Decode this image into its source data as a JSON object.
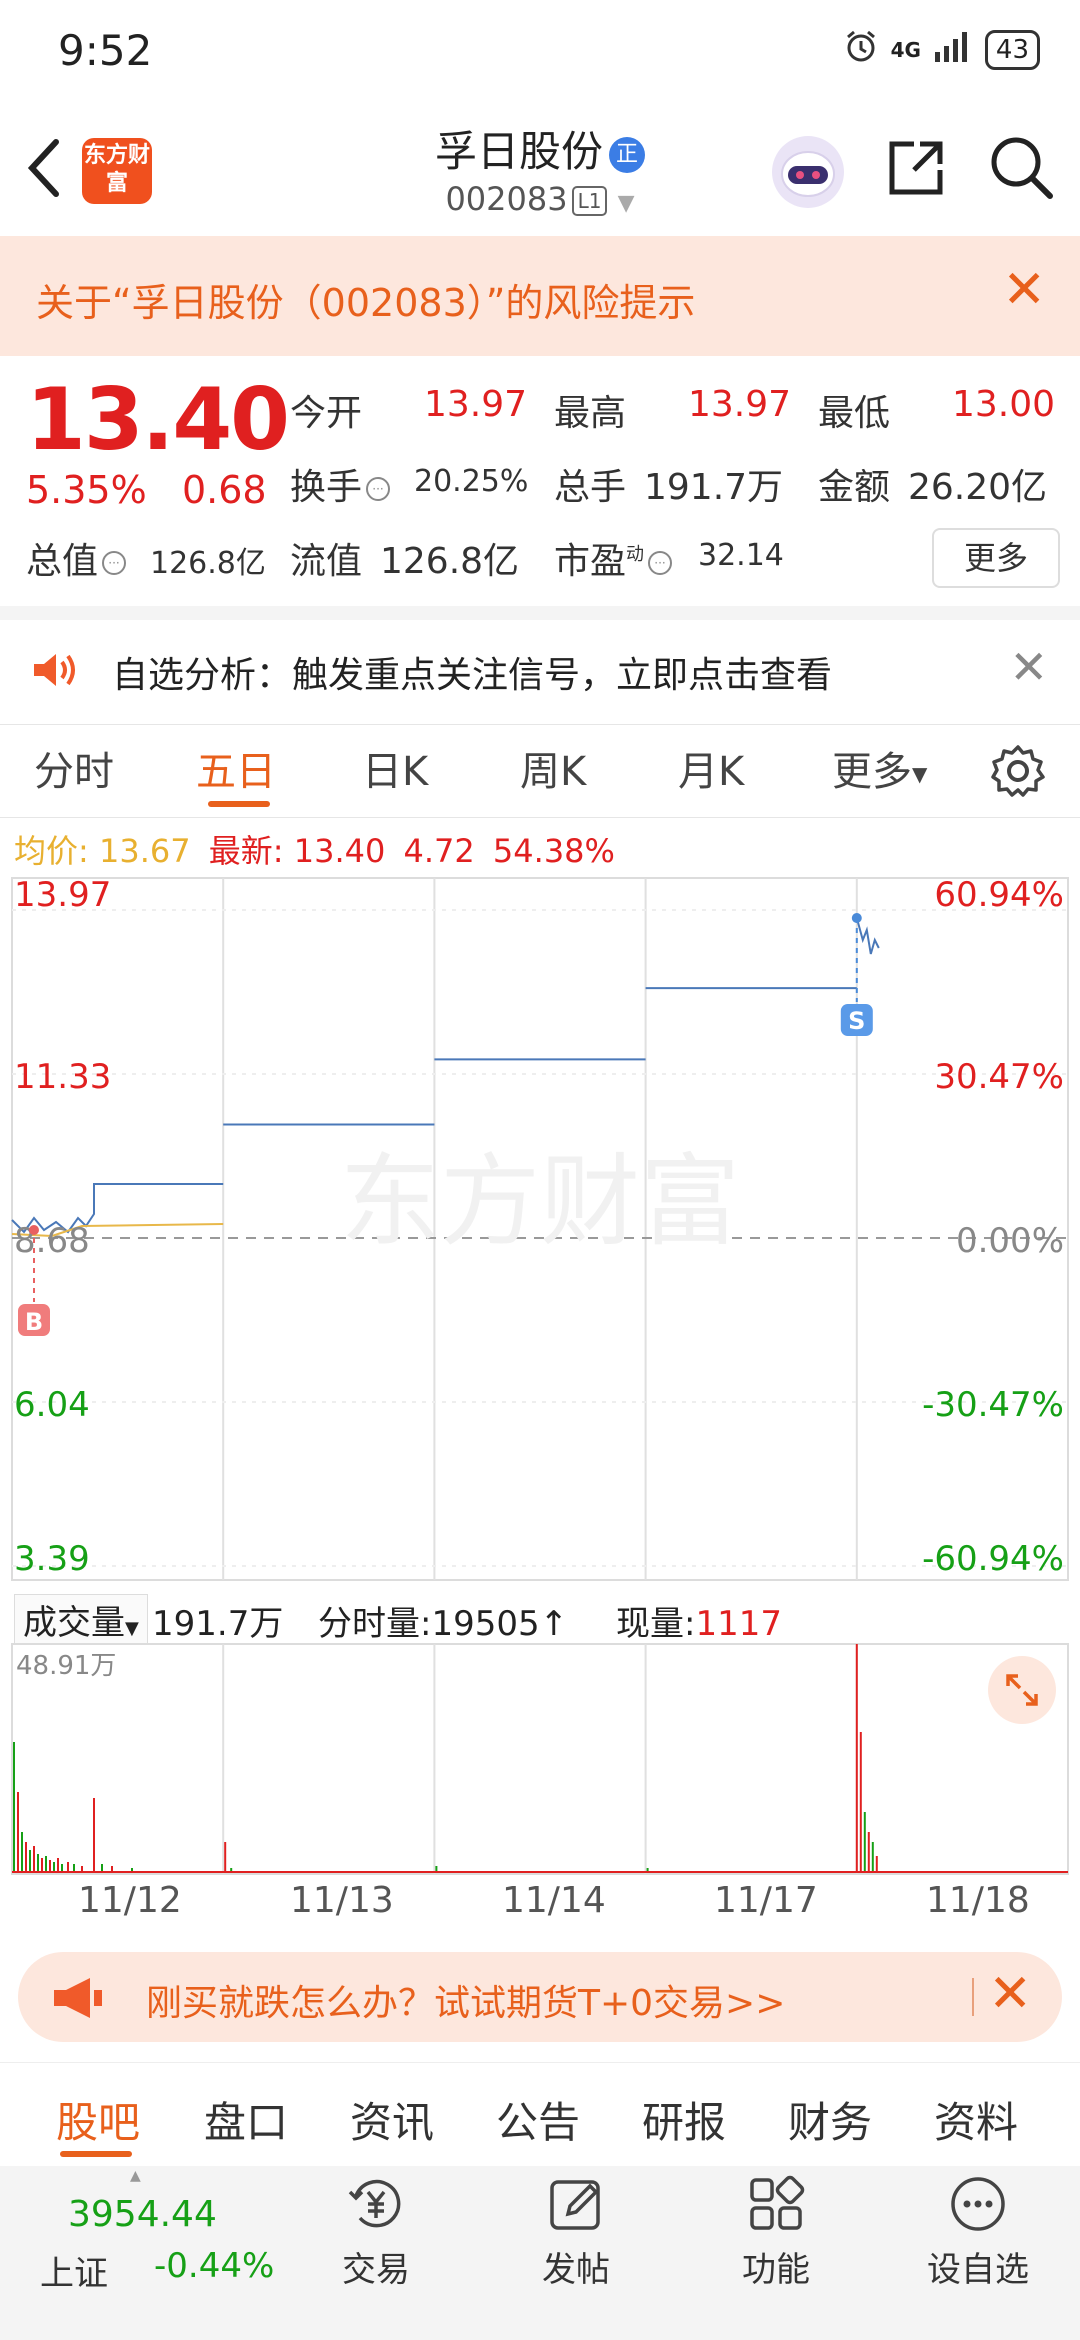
{
  "status_bar": {
    "time": "9:52",
    "network": "4G",
    "battery": "43"
  },
  "header": {
    "logo_text": "东方财富",
    "stock_name": "孚日股份",
    "name_badge": "正",
    "stock_code": "002083",
    "level": "L1"
  },
  "risk_banner": {
    "text": "关于“孚日股份（002083）”的风险提示"
  },
  "quote": {
    "price": "13.40",
    "change_pct": "5.35%",
    "change": "0.68",
    "open_label": "今开",
    "open": "13.97",
    "high_label": "最高",
    "high": "13.97",
    "low_label": "最低",
    "low": "13.00",
    "turnover_label": "换手",
    "turnover": "20.25%",
    "volume_label": "总手",
    "volume": "191.7万",
    "amount_label": "金额",
    "amount": "26.20亿",
    "total_value_label": "总值",
    "total_value": "126.8亿",
    "float_value_label": "流值",
    "float_value": "126.8亿",
    "pe_label": "市盈",
    "pe_sup": "动",
    "pe": "32.14",
    "more": "更多"
  },
  "analysis": {
    "text": "自选分析：触发重点关注信号，立即点击查看"
  },
  "tabs": [
    {
      "label": "分时"
    },
    {
      "label": "五日"
    },
    {
      "label": "日K"
    },
    {
      "label": "周K"
    },
    {
      "label": "月K"
    },
    {
      "label": "更多"
    }
  ],
  "active_tab": "五日",
  "avg_line": {
    "avg_label": "均价:",
    "avg_value": "13.67",
    "latest_label": "最新:",
    "latest_value": "13.40",
    "change": "4.72",
    "change_pct": "54.38%"
  },
  "chart": {
    "watermark": "东方财富",
    "y_labels_left": [
      "13.97",
      "11.33",
      "8.68",
      "6.04",
      "3.39"
    ],
    "y_labels_right": [
      "60.94%",
      "30.47%",
      "0.00%",
      "-30.47%",
      "-60.94%"
    ],
    "buy_marker": "B",
    "sell_marker": "S"
  },
  "chart_data": {
    "type": "line",
    "title": "",
    "x": [
      "11/12",
      "11/13",
      "11/14",
      "11/17",
      "11/18"
    ],
    "series": [
      {
        "values": [
          9.55,
          10.51,
          11.56,
          12.71,
          13.4
        ]
      }
    ],
    "ylim": [
      3.39,
      13.97
    ],
    "reference_price": 8.68,
    "volume": {
      "label": "成交量",
      "total": "191.7万",
      "interval_label": "分时量:",
      "interval_value": "19505",
      "current_label": "现量:",
      "current_value": "1117",
      "max_label": "48.91万"
    }
  },
  "promo": {
    "text": "刚买就跌怎么办？试试期货T+0交易>>"
  },
  "bottom_tabs": [
    {
      "label": "股吧"
    },
    {
      "label": "盘口"
    },
    {
      "label": "资讯"
    },
    {
      "label": "公告"
    },
    {
      "label": "研报"
    },
    {
      "label": "财务"
    },
    {
      "label": "资料"
    }
  ],
  "nav": {
    "index_value": "3954.44",
    "index_name": "上证",
    "index_change": "-0.44%",
    "items": [
      {
        "label": "交易"
      },
      {
        "label": "发帖"
      },
      {
        "label": "功能"
      },
      {
        "label": "设自选"
      }
    ]
  },
  "colors": {
    "up": "#e02020",
    "down": "#16a016",
    "accent": "#e8601c",
    "price_line": "#4a78b8",
    "avg_line": "#e8b84a"
  }
}
